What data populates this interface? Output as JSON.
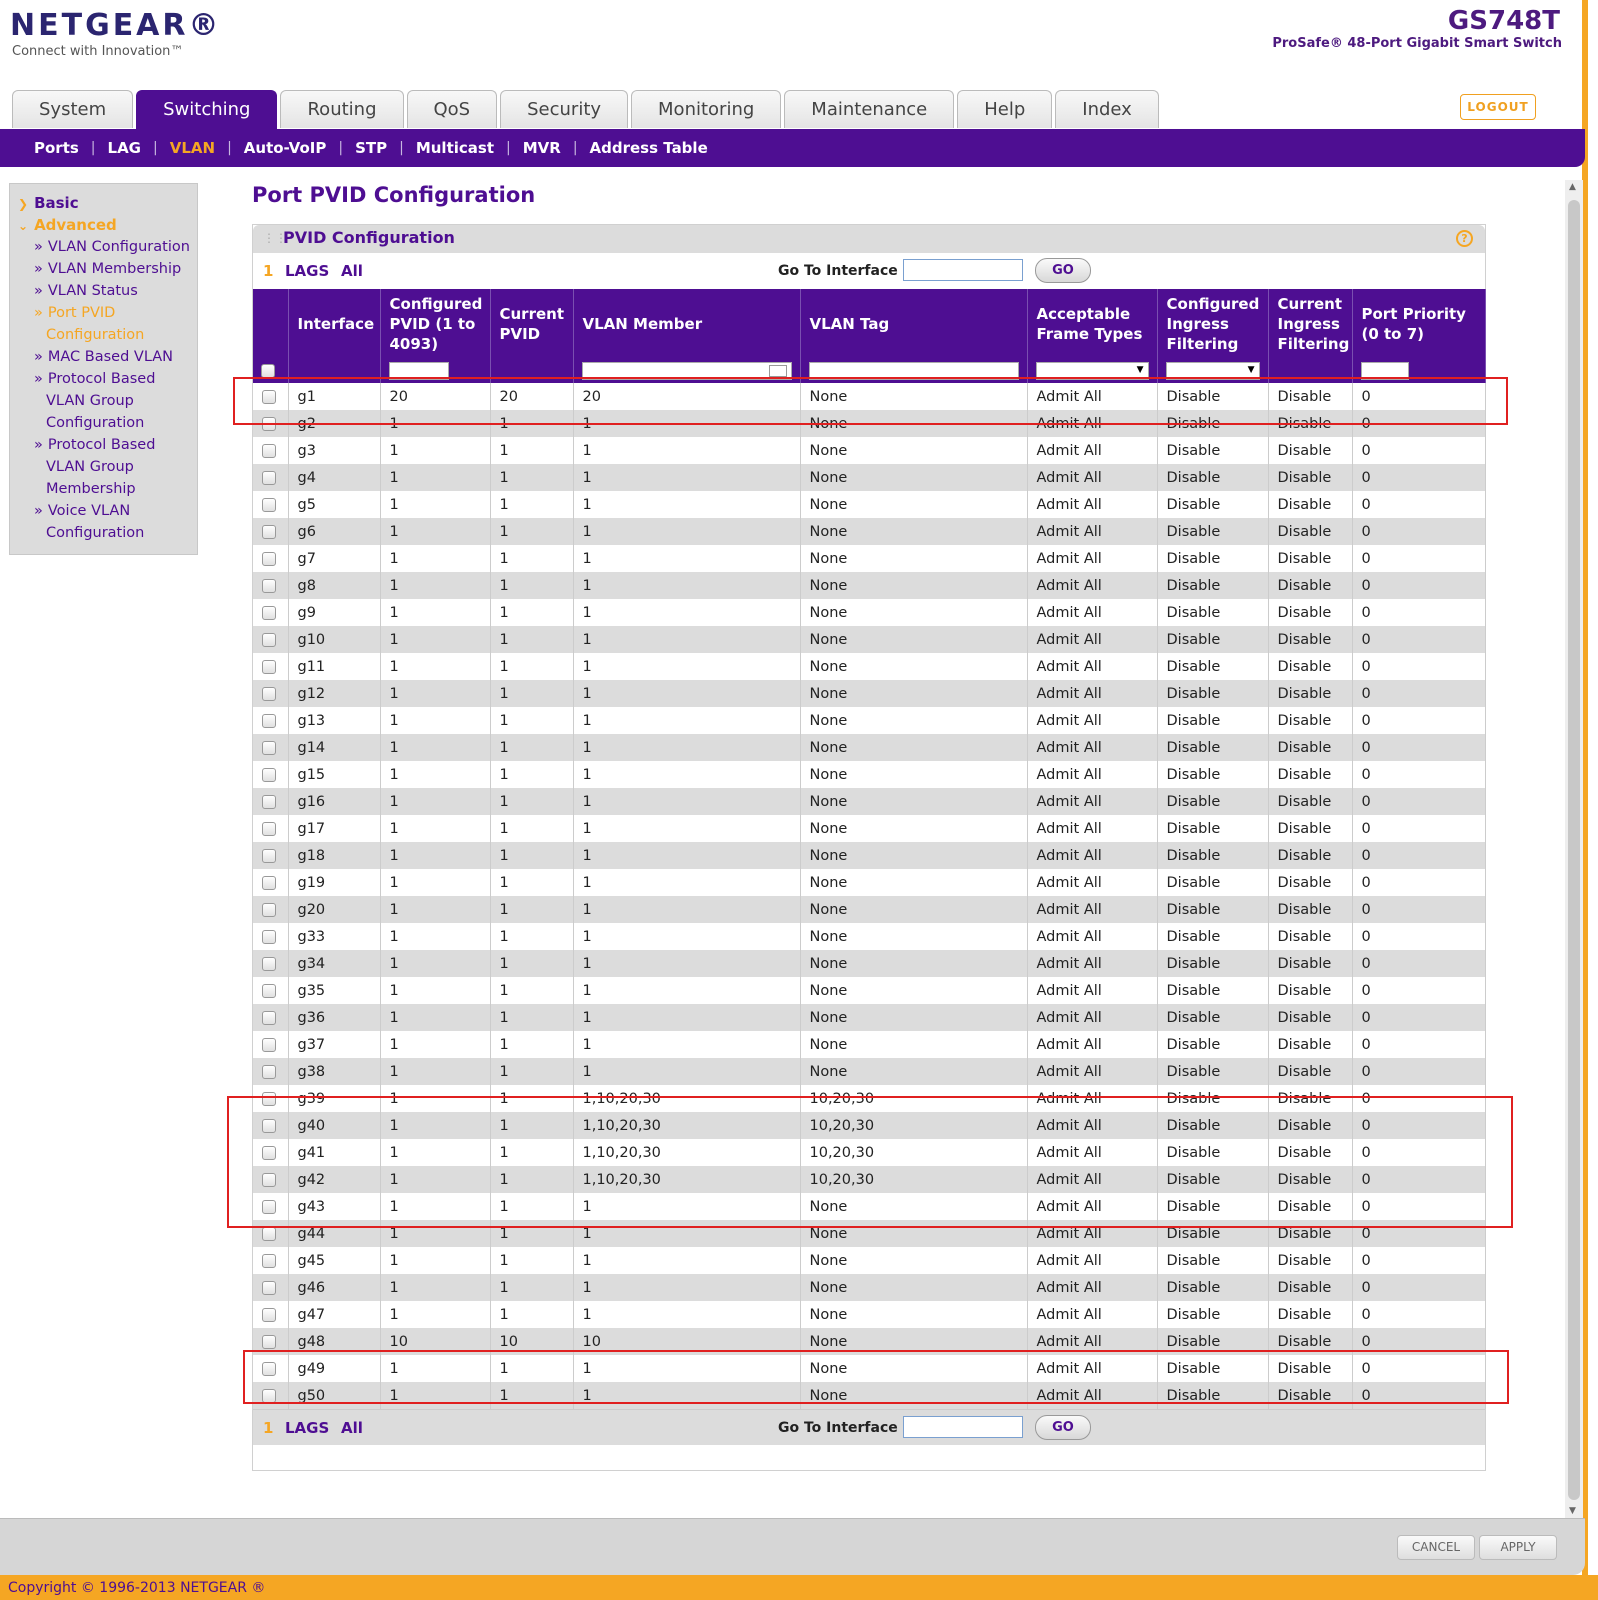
{
  "header": {
    "logo": "NETGEAR®",
    "tagline": "Connect with Innovation™",
    "model": "GS748T",
    "product": "ProSafe® 48-Port Gigabit Smart Switch",
    "logout": "LOGOUT"
  },
  "tabs": [
    {
      "label": "System"
    },
    {
      "label": "Switching",
      "active": true
    },
    {
      "label": "Routing"
    },
    {
      "label": "QoS"
    },
    {
      "label": "Security"
    },
    {
      "label": "Monitoring"
    },
    {
      "label": "Maintenance"
    },
    {
      "label": "Help"
    },
    {
      "label": "Index"
    }
  ],
  "subnav": [
    "Ports",
    "LAG",
    "VLAN",
    "Auto-VoIP",
    "STP",
    "Multicast",
    "MVR",
    "Address Table"
  ],
  "subnav_active": "VLAN",
  "sidebar": {
    "basic": "Basic",
    "advanced": "Advanced",
    "items": [
      {
        "line1": "VLAN Configuration"
      },
      {
        "line1": "VLAN Membership"
      },
      {
        "line1": "VLAN Status"
      },
      {
        "line1": "Port PVID",
        "line2": "Configuration",
        "current": true
      },
      {
        "line1": "MAC Based VLAN"
      },
      {
        "line1": "Protocol Based",
        "line2": "VLAN Group",
        "line3": "Configuration"
      },
      {
        "line1": "Protocol Based",
        "line2": "VLAN Group",
        "line3": "Membership"
      },
      {
        "line1": "Voice VLAN",
        "line2": "Configuration"
      }
    ]
  },
  "page_title": "Port PVID Configuration",
  "panel_title": "PVID Configuration",
  "pager": {
    "page": "1",
    "lags": "LAGS",
    "all": "All",
    "goto_label": "Go To Interface",
    "go": "GO"
  },
  "columns": [
    "",
    "Interface",
    "Configured PVID (1 to 4093)",
    "Current PVID",
    "VLAN Member",
    "VLAN Tag",
    "Acceptable Frame Types",
    "Configured Ingress Filtering",
    "Current Ingress Filtering",
    "Port Priority (0 to 7)"
  ],
  "rows": [
    [
      "g1",
      "20",
      "20",
      "20",
      "None",
      "Admit All",
      "Disable",
      "Disable",
      "0"
    ],
    [
      "g2",
      "1",
      "1",
      "1",
      "None",
      "Admit All",
      "Disable",
      "Disable",
      "0"
    ],
    [
      "g3",
      "1",
      "1",
      "1",
      "None",
      "Admit All",
      "Disable",
      "Disable",
      "0"
    ],
    [
      "g4",
      "1",
      "1",
      "1",
      "None",
      "Admit All",
      "Disable",
      "Disable",
      "0"
    ],
    [
      "g5",
      "1",
      "1",
      "1",
      "None",
      "Admit All",
      "Disable",
      "Disable",
      "0"
    ],
    [
      "g6",
      "1",
      "1",
      "1",
      "None",
      "Admit All",
      "Disable",
      "Disable",
      "0"
    ],
    [
      "g7",
      "1",
      "1",
      "1",
      "None",
      "Admit All",
      "Disable",
      "Disable",
      "0"
    ],
    [
      "g8",
      "1",
      "1",
      "1",
      "None",
      "Admit All",
      "Disable",
      "Disable",
      "0"
    ],
    [
      "g9",
      "1",
      "1",
      "1",
      "None",
      "Admit All",
      "Disable",
      "Disable",
      "0"
    ],
    [
      "g10",
      "1",
      "1",
      "1",
      "None",
      "Admit All",
      "Disable",
      "Disable",
      "0"
    ],
    [
      "g11",
      "1",
      "1",
      "1",
      "None",
      "Admit All",
      "Disable",
      "Disable",
      "0"
    ],
    [
      "g12",
      "1",
      "1",
      "1",
      "None",
      "Admit All",
      "Disable",
      "Disable",
      "0"
    ],
    [
      "g13",
      "1",
      "1",
      "1",
      "None",
      "Admit All",
      "Disable",
      "Disable",
      "0"
    ],
    [
      "g14",
      "1",
      "1",
      "1",
      "None",
      "Admit All",
      "Disable",
      "Disable",
      "0"
    ],
    [
      "g15",
      "1",
      "1",
      "1",
      "None",
      "Admit All",
      "Disable",
      "Disable",
      "0"
    ],
    [
      "g16",
      "1",
      "1",
      "1",
      "None",
      "Admit All",
      "Disable",
      "Disable",
      "0"
    ],
    [
      "g17",
      "1",
      "1",
      "1",
      "None",
      "Admit All",
      "Disable",
      "Disable",
      "0"
    ],
    [
      "g18",
      "1",
      "1",
      "1",
      "None",
      "Admit All",
      "Disable",
      "Disable",
      "0"
    ],
    [
      "g19",
      "1",
      "1",
      "1",
      "None",
      "Admit All",
      "Disable",
      "Disable",
      "0"
    ],
    [
      "g20",
      "1",
      "1",
      "1",
      "None",
      "Admit All",
      "Disable",
      "Disable",
      "0"
    ],
    [
      "g33",
      "1",
      "1",
      "1",
      "None",
      "Admit All",
      "Disable",
      "Disable",
      "0"
    ],
    [
      "g34",
      "1",
      "1",
      "1",
      "None",
      "Admit All",
      "Disable",
      "Disable",
      "0"
    ],
    [
      "g35",
      "1",
      "1",
      "1",
      "None",
      "Admit All",
      "Disable",
      "Disable",
      "0"
    ],
    [
      "g36",
      "1",
      "1",
      "1",
      "None",
      "Admit All",
      "Disable",
      "Disable",
      "0"
    ],
    [
      "g37",
      "1",
      "1",
      "1",
      "None",
      "Admit All",
      "Disable",
      "Disable",
      "0"
    ],
    [
      "g38",
      "1",
      "1",
      "1",
      "None",
      "Admit All",
      "Disable",
      "Disable",
      "0"
    ],
    [
      "g39",
      "1",
      "1",
      "1,10,20,30",
      "10,20,30",
      "Admit All",
      "Disable",
      "Disable",
      "0"
    ],
    [
      "g40",
      "1",
      "1",
      "1,10,20,30",
      "10,20,30",
      "Admit All",
      "Disable",
      "Disable",
      "0"
    ],
    [
      "g41",
      "1",
      "1",
      "1,10,20,30",
      "10,20,30",
      "Admit All",
      "Disable",
      "Disable",
      "0"
    ],
    [
      "g42",
      "1",
      "1",
      "1,10,20,30",
      "10,20,30",
      "Admit All",
      "Disable",
      "Disable",
      "0"
    ],
    [
      "g43",
      "1",
      "1",
      "1",
      "None",
      "Admit All",
      "Disable",
      "Disable",
      "0"
    ],
    [
      "g44",
      "1",
      "1",
      "1",
      "None",
      "Admit All",
      "Disable",
      "Disable",
      "0"
    ],
    [
      "g45",
      "1",
      "1",
      "1",
      "None",
      "Admit All",
      "Disable",
      "Disable",
      "0"
    ],
    [
      "g46",
      "1",
      "1",
      "1",
      "None",
      "Admit All",
      "Disable",
      "Disable",
      "0"
    ],
    [
      "g47",
      "1",
      "1",
      "1",
      "None",
      "Admit All",
      "Disable",
      "Disable",
      "0"
    ],
    [
      "g48",
      "10",
      "10",
      "10",
      "None",
      "Admit All",
      "Disable",
      "Disable",
      "0"
    ],
    [
      "g49",
      "1",
      "1",
      "1",
      "None",
      "Admit All",
      "Disable",
      "Disable",
      "0"
    ],
    [
      "g50",
      "1",
      "1",
      "1",
      "None",
      "Admit All",
      "Disable",
      "Disable",
      "0"
    ]
  ],
  "footer": {
    "cancel": "CANCEL",
    "apply": "APPLY",
    "copyright": "Copyright © 1996-2013 NETGEAR ®"
  },
  "colors": {
    "brand_purple": "#4e0e92",
    "accent_orange": "#f5a623",
    "highlight_red": "#e02020"
  }
}
